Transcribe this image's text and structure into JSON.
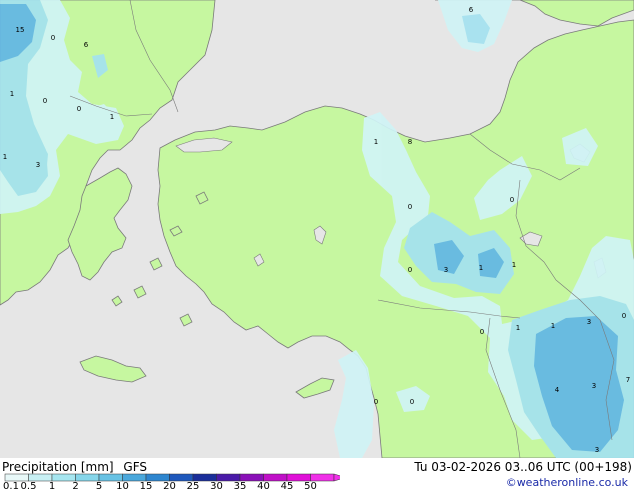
{
  "header": {
    "product": "Precipitation [mm]",
    "model": "GFS",
    "valid_time": "Tu 03-02-2026 03..06 UTC (00+198)"
  },
  "credit": "©weatheronline.co.uk",
  "legend": {
    "labels": [
      "0.1",
      "0.5",
      "1",
      "2",
      "5",
      "10",
      "15",
      "20",
      "25",
      "30",
      "35",
      "40",
      "45",
      "50"
    ],
    "colors": [
      "#e8f8f8",
      "#c8f0f4",
      "#a6e6f0",
      "#86d6ea",
      "#68c2e4",
      "#4aa8dc",
      "#2e86cf",
      "#1e58bc",
      "#1a2e9a",
      "#4a1aa8",
      "#8a10b8",
      "#c010c8",
      "#e010d8",
      "#f030e8"
    ]
  },
  "colors": {
    "sea": "#e6e6e6",
    "land": "#c6f7a0",
    "precip_light": "#d0f4f6",
    "precip_medium": "#a4e2f0",
    "precip_heavy": "#62b6e6"
  },
  "map_labels": [
    "15",
    "0",
    "6",
    "1",
    "0",
    "0",
    "1",
    "1",
    "3",
    "1",
    "8",
    "6",
    "0",
    "0",
    "0",
    "3",
    "1",
    "1",
    "0",
    "1",
    "1",
    "3",
    "0",
    "4",
    "3",
    "7",
    "0",
    "0",
    "3"
  ]
}
